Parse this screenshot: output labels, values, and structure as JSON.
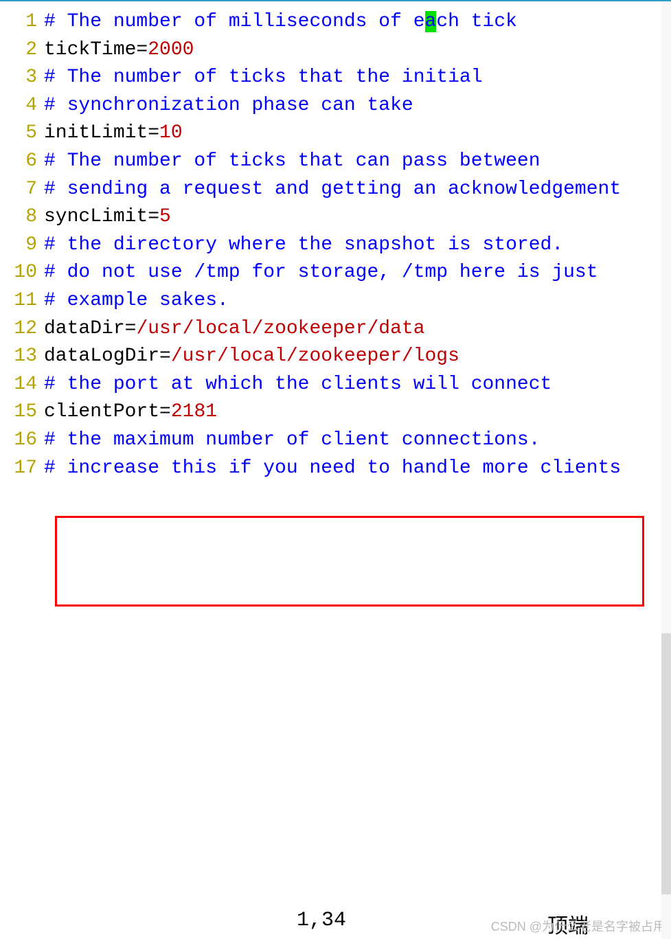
{
  "lines": [
    {
      "num": "1",
      "tokens": [
        [
          "c-comment",
          "# The number of milliseconds of e"
        ],
        [
          "cursor-hl",
          "a"
        ],
        [
          "c-comment",
          "ch tick"
        ]
      ]
    },
    {
      "num": "2",
      "tokens": [
        [
          "c-key",
          "tickTime"
        ],
        [
          "c-op",
          "="
        ],
        [
          "c-num",
          "2000"
        ]
      ]
    },
    {
      "num": "3",
      "tokens": [
        [
          "c-comment",
          "# The number of ticks that the initial"
        ]
      ]
    },
    {
      "num": "4",
      "tokens": [
        [
          "c-comment",
          "# synchronization phase can take"
        ]
      ]
    },
    {
      "num": "5",
      "tokens": [
        [
          "c-key",
          "initLimit"
        ],
        [
          "c-op",
          "="
        ],
        [
          "c-num",
          "10"
        ]
      ]
    },
    {
      "num": "6",
      "tokens": [
        [
          "c-comment",
          "# The number of ticks that can pass between"
        ]
      ]
    },
    {
      "num": "7",
      "tokens": [
        [
          "c-comment",
          "# sending a request and getting an acknowledgement"
        ]
      ]
    },
    {
      "num": "8",
      "tokens": [
        [
          "c-key",
          "syncLimit"
        ],
        [
          "c-op",
          "="
        ],
        [
          "c-num",
          "5"
        ]
      ]
    },
    {
      "num": "9",
      "tokens": [
        [
          "c-comment",
          "# the directory where the snapshot is stored."
        ]
      ]
    },
    {
      "num": "10",
      "tokens": [
        [
          "c-comment",
          "# do not use /tmp for storage, /tmp here is just"
        ]
      ]
    },
    {
      "num": "11",
      "tokens": [
        [
          "c-comment",
          "# example sakes."
        ]
      ]
    },
    {
      "num": "12",
      "tokens": [
        [
          "c-key",
          "dataDir"
        ],
        [
          "c-op",
          "="
        ],
        [
          "c-path",
          "/usr/local/zookeeper/data"
        ]
      ]
    },
    {
      "num": "13",
      "tokens": [
        [
          "c-key",
          "dataLogDir"
        ],
        [
          "c-op",
          "="
        ],
        [
          "c-path",
          "/usr/local/zookeeper/logs"
        ]
      ]
    },
    {
      "num": "14",
      "tokens": [
        [
          "c-comment",
          "# the port at which the clients will connect"
        ]
      ]
    },
    {
      "num": "15",
      "tokens": [
        [
          "c-key",
          "clientPort"
        ],
        [
          "c-op",
          "="
        ],
        [
          "c-num",
          "2181"
        ]
      ]
    },
    {
      "num": "16",
      "tokens": [
        [
          "c-comment",
          "# the maximum number of client connections."
        ]
      ]
    },
    {
      "num": "17",
      "tokens": [
        [
          "c-comment",
          "# increase this if you need to handle more clients"
        ]
      ]
    }
  ],
  "status": {
    "position": "1,34",
    "mode": "顶端"
  },
  "watermark": "CSDN @为什么老是名字被占用",
  "colors": {
    "comment": "#0000ff",
    "number": "#c00000",
    "line_number": "#b5a400",
    "highlight_border": "#ff0000",
    "cursor_bg": "#00e000"
  }
}
